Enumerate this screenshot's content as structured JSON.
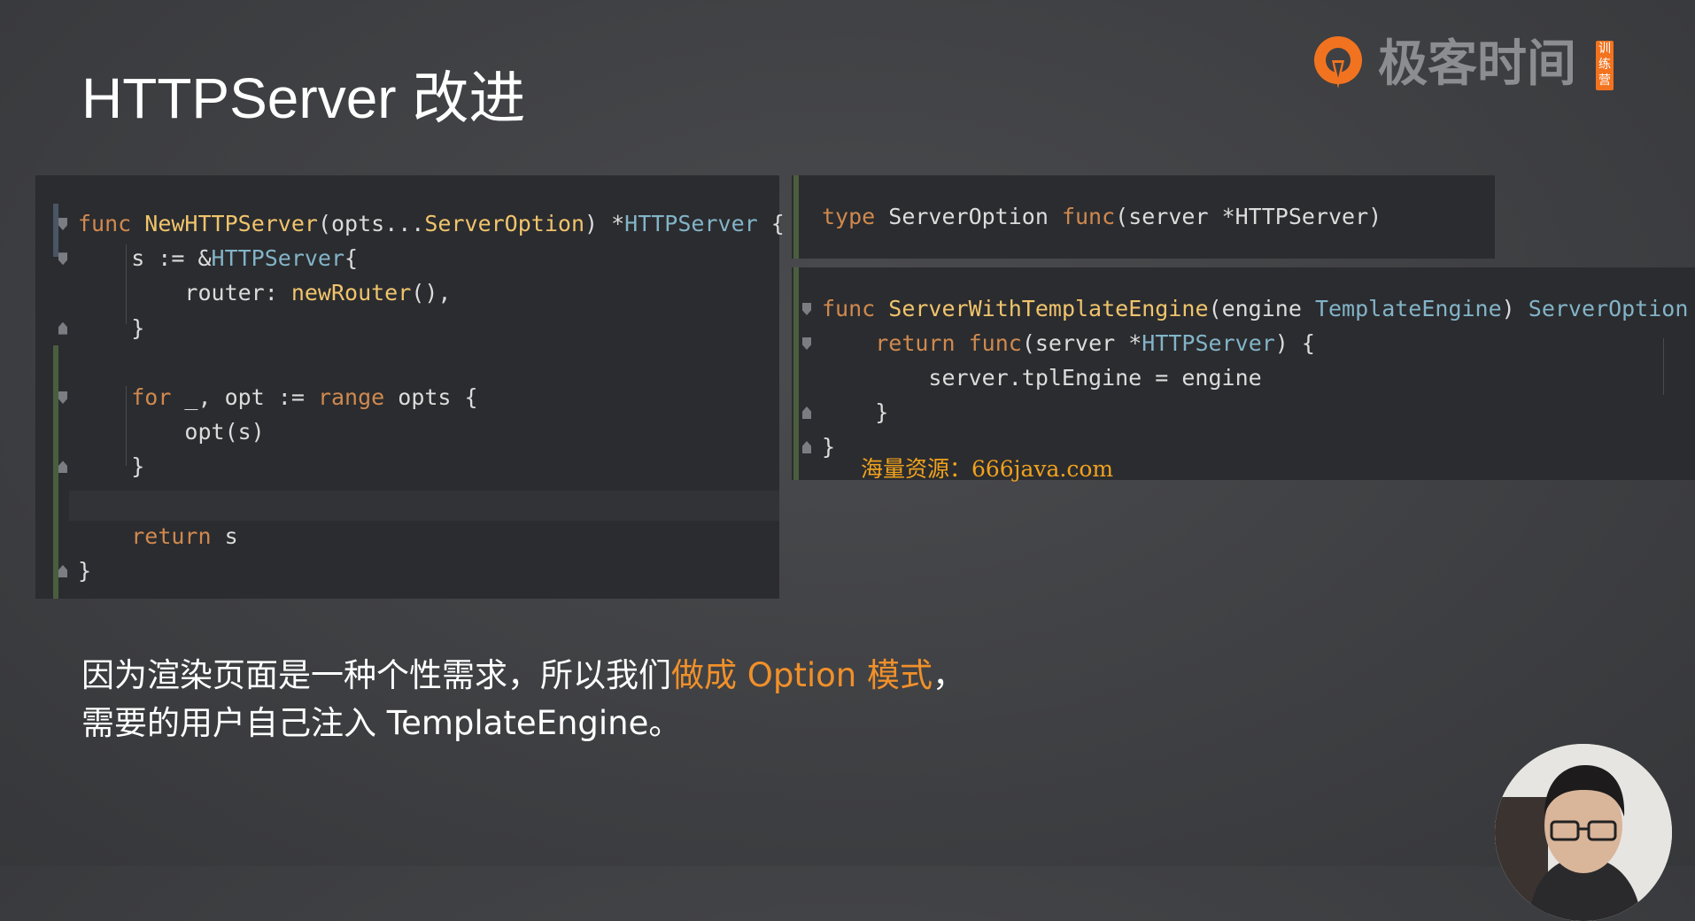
{
  "slide": {
    "title": "HTTPServer 改进"
  },
  "logo": {
    "brand_text": "极客时间",
    "badge_text": "训练营"
  },
  "left_code": {
    "lines": [
      [
        {
          "t": "func",
          "c": "kw"
        },
        {
          "t": " ",
          "c": "pl"
        },
        {
          "t": "NewHTTPServer",
          "c": "fn"
        },
        {
          "t": "(opts...",
          "c": "pl"
        },
        {
          "t": "ServerOption",
          "c": "fn"
        },
        {
          "t": ") *",
          "c": "pl"
        },
        {
          "t": "HTTPServer",
          "c": "ty"
        },
        {
          "t": " {",
          "c": "pl"
        }
      ],
      [
        {
          "t": "    s := &",
          "c": "pl"
        },
        {
          "t": "HTTPServer",
          "c": "ty"
        },
        {
          "t": "{",
          "c": "pl"
        }
      ],
      [
        {
          "t": "        router: ",
          "c": "pl"
        },
        {
          "t": "newRouter",
          "c": "fn"
        },
        {
          "t": "(),",
          "c": "pl"
        }
      ],
      [
        {
          "t": "    }",
          "c": "pl"
        }
      ],
      [],
      [
        {
          "t": "    ",
          "c": "pl"
        },
        {
          "t": "for",
          "c": "kw"
        },
        {
          "t": " _, opt := ",
          "c": "pl"
        },
        {
          "t": "range",
          "c": "kw"
        },
        {
          "t": " opts {",
          "c": "pl"
        }
      ],
      [
        {
          "t": "        opt(s)",
          "c": "pl"
        }
      ],
      [
        {
          "t": "    }",
          "c": "pl"
        }
      ],
      [],
      [
        {
          "t": "    ",
          "c": "pl"
        },
        {
          "t": "return",
          "c": "kw"
        },
        {
          "t": " s",
          "c": "pl"
        }
      ],
      [
        {
          "t": "}",
          "c": "pl"
        }
      ]
    ]
  },
  "right_top_code": {
    "lines": [
      [
        {
          "t": "type",
          "c": "kw"
        },
        {
          "t": " ServerOption ",
          "c": "pl"
        },
        {
          "t": "func",
          "c": "kw"
        },
        {
          "t": "(server *HTTPServer)",
          "c": "pl"
        }
      ]
    ]
  },
  "right_bottom_code": {
    "lines": [
      [
        {
          "t": "func",
          "c": "kw"
        },
        {
          "t": " ",
          "c": "pl"
        },
        {
          "t": "ServerWithTemplateEngine",
          "c": "fn"
        },
        {
          "t": "(engine ",
          "c": "pl"
        },
        {
          "t": "TemplateEngine",
          "c": "ty"
        },
        {
          "t": ") ",
          "c": "pl"
        },
        {
          "t": "ServerOption",
          "c": "ty"
        },
        {
          "t": " {",
          "c": "pl"
        }
      ],
      [
        {
          "t": "    ",
          "c": "pl"
        },
        {
          "t": "return",
          "c": "kw"
        },
        {
          "t": " ",
          "c": "pl"
        },
        {
          "t": "func",
          "c": "kw"
        },
        {
          "t": "(server *",
          "c": "pl"
        },
        {
          "t": "HTTPServer",
          "c": "ty"
        },
        {
          "t": ") {",
          "c": "pl"
        }
      ],
      [
        {
          "t": "        server.tplEngine = engine",
          "c": "pl"
        }
      ],
      [
        {
          "t": "    }",
          "c": "pl"
        }
      ],
      [
        {
          "t": "}",
          "c": "pl"
        }
      ]
    ]
  },
  "watermark": "海量资源：666java.com",
  "caption": {
    "line1_prefix": "因为渲染页面是一种个性需求，所以我们",
    "line1_highlight": "做成 Option 模式",
    "line1_suffix": "，",
    "line2": "需要的用户自己注入 TemplateEngine。"
  },
  "colors": {
    "keyword": "#d0894f",
    "function": "#f0c46c",
    "type": "#82b4c8",
    "highlight": "#f0902a",
    "brand_orange": "#f2731f"
  }
}
